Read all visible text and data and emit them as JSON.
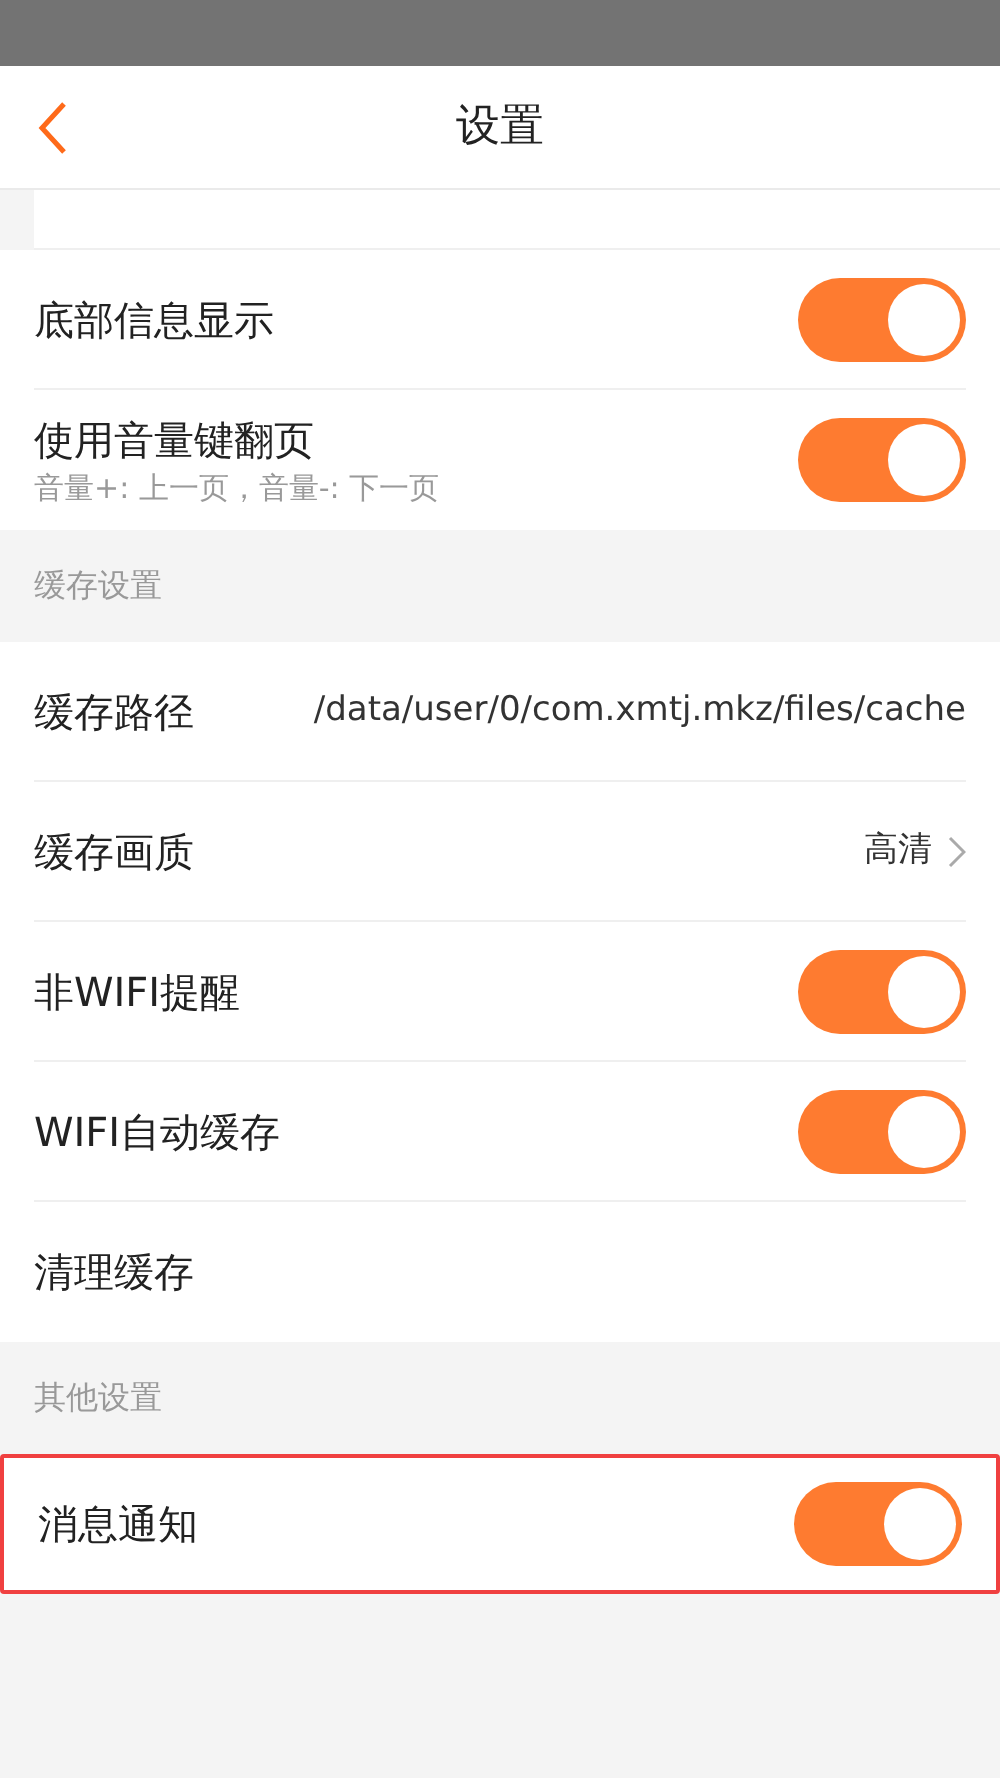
{
  "header": {
    "title": "设置"
  },
  "sections": [
    {
      "items": [
        {
          "kind": "toggle",
          "label": "底部信息显示",
          "on": true,
          "highlighted": false
        },
        {
          "kind": "toggle",
          "label": "使用音量键翻页",
          "subtitle": "音量+: 上一页，音量-: 下一页",
          "on": true,
          "highlighted": false
        }
      ]
    },
    {
      "title": "缓存设置",
      "items": [
        {
          "kind": "value",
          "label": "缓存路径",
          "value": "/data/user/0/com.xmtj.mkz/files/cache",
          "highlighted": false
        },
        {
          "kind": "link",
          "label": "缓存画质",
          "value": "高清",
          "highlighted": false
        },
        {
          "kind": "toggle",
          "label": "非WIFI提醒",
          "on": true,
          "highlighted": false
        },
        {
          "kind": "toggle",
          "label": "WIFI自动缓存",
          "on": true,
          "highlighted": false
        },
        {
          "kind": "plain",
          "label": "清理缓存",
          "highlighted": false
        }
      ]
    },
    {
      "title": "其他设置",
      "items": [
        {
          "kind": "toggle",
          "label": "消息通知",
          "on": true,
          "highlighted": true
        }
      ]
    }
  ]
}
